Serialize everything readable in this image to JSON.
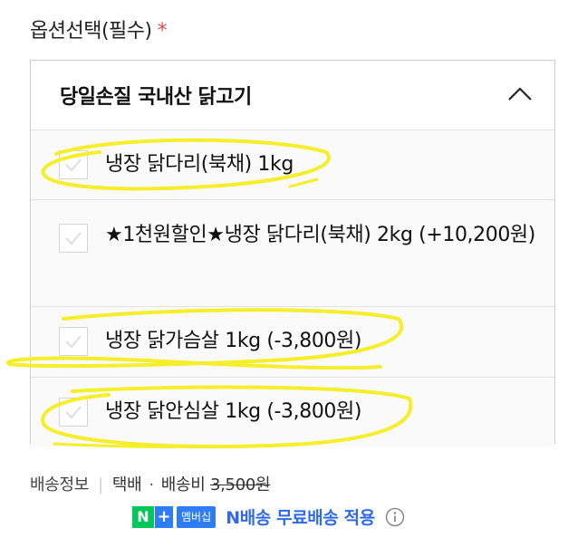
{
  "option_header": {
    "title": "옵션선택(필수)",
    "required_mark": "*"
  },
  "product": {
    "name": "당일손질 국내산 닭고기"
  },
  "options": [
    {
      "label": "냉장 닭다리(북채) 1kg",
      "checked": false
    },
    {
      "label": "★1천원할인★냉장 닭다리(북채) 2kg (+10,200원)",
      "checked": false
    },
    {
      "label": "냉장 닭가슴살 1kg (-3,800원)",
      "checked": false
    },
    {
      "label": "냉장 닭안심살 1kg (-3,800원)",
      "checked": false
    }
  ],
  "shipping": {
    "label": "배송정보",
    "method": "택배",
    "fee_label": "배송비",
    "fee": "3,500원"
  },
  "membership": {
    "n_badge": "N",
    "plus_badge": "+",
    "member_badge": "멤버십",
    "text": "N배송 무료배송 적용"
  },
  "colors": {
    "highlight": "#f5ee2a",
    "required": "#e54b4b",
    "naver_green": "#03c75a",
    "membership_blue": "#2f6be8"
  },
  "icons": {
    "collapse": "chevron-up-icon",
    "checkbox": "check-icon",
    "info": "info-circle-icon"
  }
}
